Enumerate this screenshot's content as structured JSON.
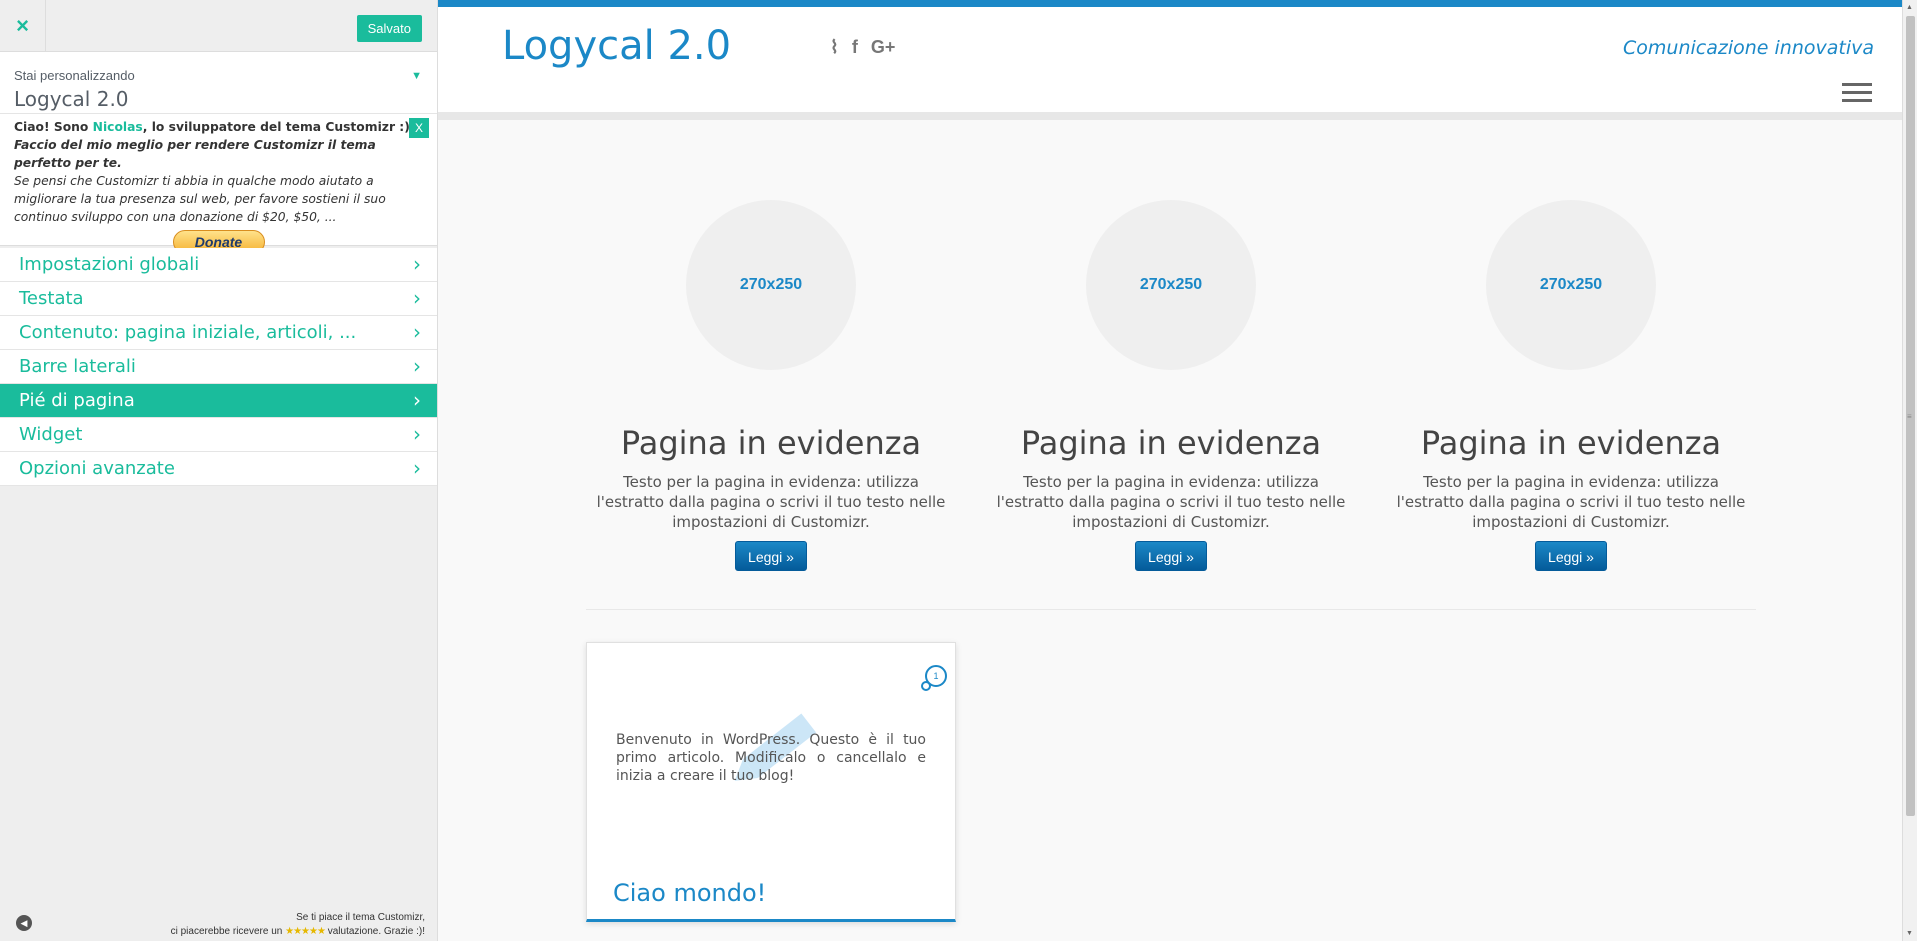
{
  "sidebar": {
    "close_icon": "×",
    "save_label": "Salvato",
    "info_sub": "Stai personalizzando",
    "info_title": "Logycal 2.0",
    "notice": {
      "line1_a": "Ciao! Sono ",
      "line1_name": "Nicolas",
      "line1_b": ", lo sviluppatore del tema Customizr :).",
      "line2": "Faccio del mio meglio per rendere Customizr il tema perfetto per te.",
      "line3": "Se pensi che Customizr ti abbia in qualche modo aiutato a migliorare la tua presenza sul web, per favore sostieni il suo continuo sviluppo con una donazione di $20, $50, ...",
      "close_label": "X",
      "donate_label": "Donate"
    },
    "menu": [
      {
        "label": "Impostazioni globali"
      },
      {
        "label": "Testata"
      },
      {
        "label": "Contenuto: pagina iniziale, articoli, ..."
      },
      {
        "label": "Barre laterali"
      },
      {
        "label": "Pié di pagina"
      },
      {
        "label": "Widget"
      },
      {
        "label": "Opzioni avanzate"
      }
    ],
    "active_item": "Pié di pagina",
    "footer": {
      "rating_line1": "Se ti piace il tema Customizr,",
      "rating_line2_a": "ci piacerebbe ricevere un ",
      "stars": "★★★★★",
      "rating_line2_b": " valutazione. Grazie :)!"
    }
  },
  "preview": {
    "site_title": "Logycal 2.0",
    "tagline": "Comunicazione innovativa",
    "socials": [
      "rss-icon",
      "facebook-icon",
      "google-plus-icon"
    ],
    "social_glyphs": [
      "⌇",
      "f",
      "G+"
    ],
    "featured": [
      {
        "thumb": "270x250",
        "title": "Pagina in evidenza",
        "text": "Testo per la pagina in evidenza: utilizza l'estratto dalla pagina o scrivi il tuo testo nelle impostazioni di Customizr.",
        "button": "Leggi »"
      },
      {
        "thumb": "270x250",
        "title": "Pagina in evidenza",
        "text": "Testo per la pagina in evidenza: utilizza l'estratto dalla pagina o scrivi il tuo testo nelle impostazioni di Customizr.",
        "button": "Leggi »"
      },
      {
        "thumb": "270x250",
        "title": "Pagina in evidenza",
        "text": "Testo per la pagina in evidenza: utilizza l'estratto dalla pagina o scrivi il tuo testo nelle impostazioni di Customizr.",
        "button": "Leggi »"
      }
    ],
    "post": {
      "comment_count": "1",
      "excerpt": "Benvenuto in WordPress. Questo è il tuo primo articolo. Modificalo o cancellalo e inizia a creare il tuo blog!",
      "title": "Ciao mondo!"
    }
  },
  "colors": {
    "accent": "#1abc9c",
    "brand": "#1b88c7"
  }
}
